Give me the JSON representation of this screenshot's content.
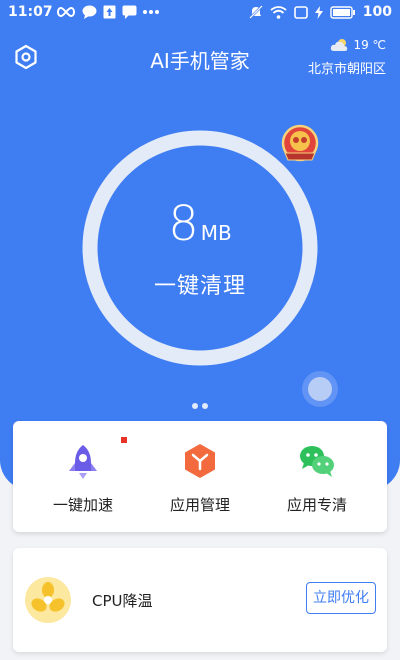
{
  "status_bar": {
    "time": "11:07",
    "left_icons": [
      "infinity-icon",
      "chat-bubble-icon",
      "upload-box-icon",
      "message-icon",
      "more-dots-icon"
    ],
    "right_icons": [
      "mute-icon",
      "wifi-icon",
      "screen-icon",
      "charging-icon",
      "battery-icon"
    ],
    "battery": "100"
  },
  "header": {
    "title": "AI手机管家",
    "settings_icon": "settings-hex-icon"
  },
  "weather": {
    "icon": "cloudy-icon",
    "temperature": "19 ℃",
    "city": "北京市朝阳区"
  },
  "cleaner": {
    "value": "8",
    "unit": "MB",
    "action_label": "一键清理"
  },
  "pager": {
    "pages": 2
  },
  "quick_actions": [
    {
      "label": "一键加速",
      "icon": "rocket-icon",
      "color": "#6b5ce7",
      "has_notice": true
    },
    {
      "label": "应用管理",
      "icon": "app-cube-icon",
      "color": "#f26a3d",
      "has_notice": false
    },
    {
      "label": "应用专清",
      "icon": "wechat-icon",
      "color": "#2ec05a",
      "has_notice": false
    }
  ],
  "cpu": {
    "label": "CPU降温",
    "icon": "fan-icon",
    "button_label": "立即优化"
  },
  "colors": {
    "primary": "#3f7df3",
    "background": "#f2f3f6",
    "notice": "#e8332a"
  }
}
